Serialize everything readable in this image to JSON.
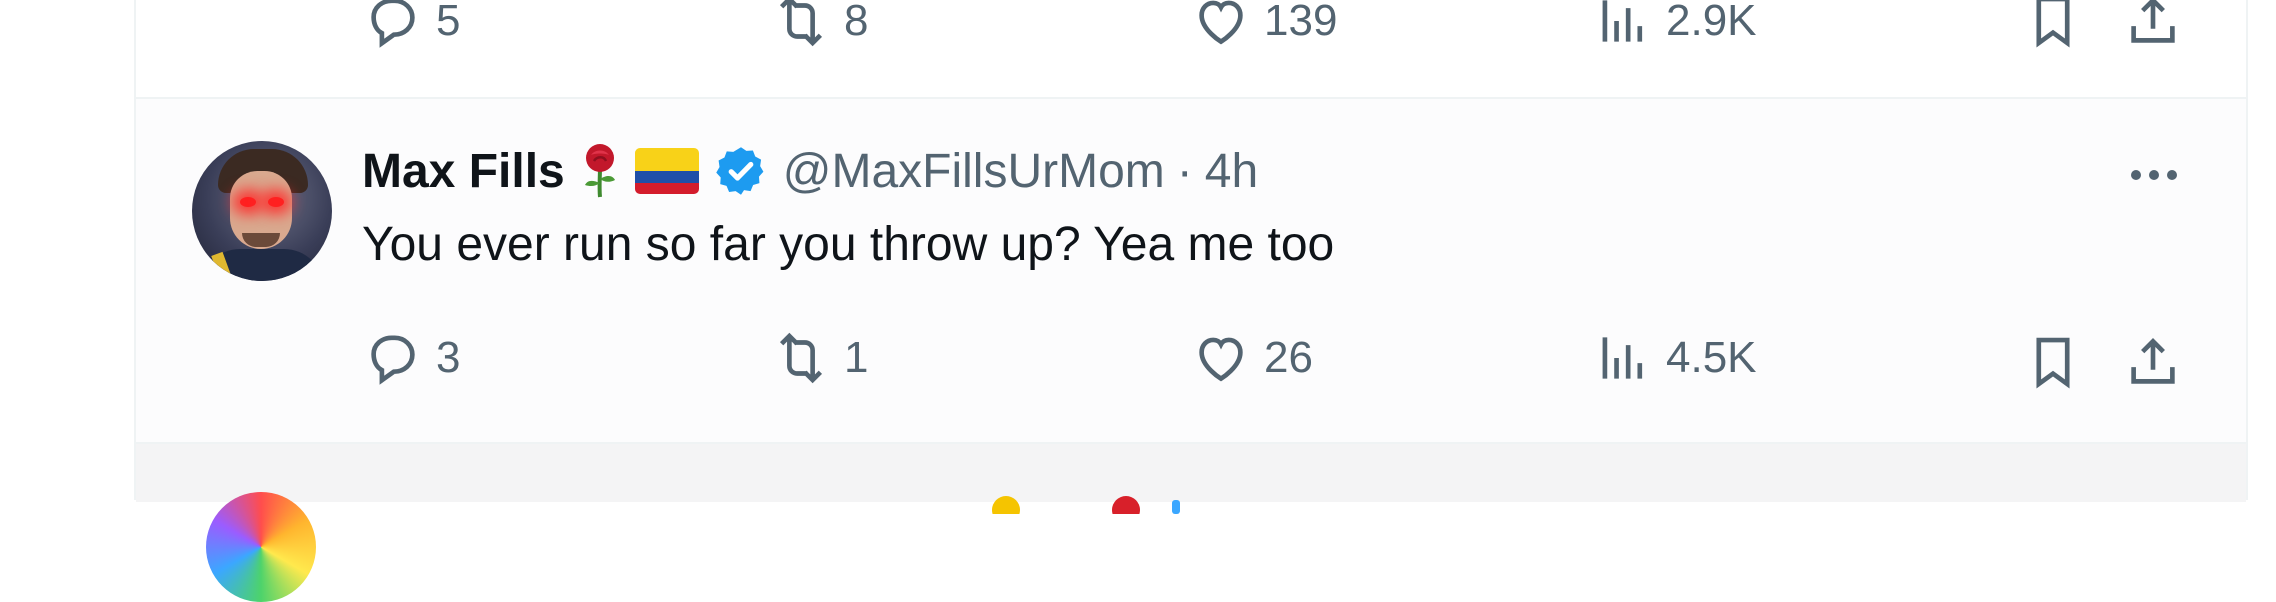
{
  "previous_tweet": {
    "actions": {
      "replies": "5",
      "reposts": "8",
      "likes": "139",
      "views": "2.9K"
    }
  },
  "tweet": {
    "author": {
      "name": "Max Fills",
      "emoji": [
        "rose-emoji",
        "colombia-flag"
      ],
      "verified": true,
      "handle": "@MaxFillsUrMom"
    },
    "separator": "·",
    "time": "4h",
    "text": "You ever run so far you throw up? Yea me too",
    "actions": {
      "replies": "3",
      "reposts": "1",
      "likes": "26",
      "views": "4.5K"
    }
  },
  "colors": {
    "text_primary": "#0f1419",
    "text_secondary": "#536471",
    "verified_blue": "#1d9bf0",
    "border": "#eff3f4"
  }
}
